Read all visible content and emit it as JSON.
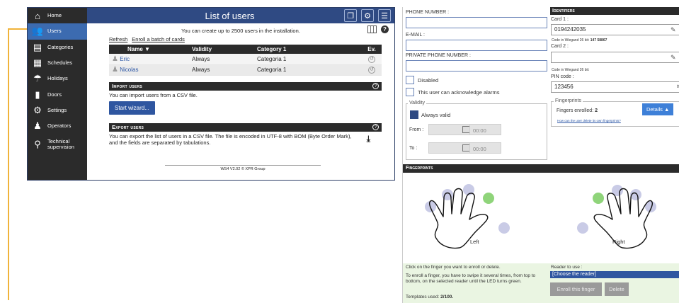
{
  "sidebar": {
    "items": [
      {
        "label": "Home",
        "icon": "home-icon",
        "active": false
      },
      {
        "label": "Users",
        "icon": "users-icon",
        "active": true
      },
      {
        "label": "Categories",
        "icon": "categories-icon",
        "active": false
      },
      {
        "label": "Schedules",
        "icon": "calendar-icon",
        "active": false
      },
      {
        "label": "Holidays",
        "icon": "holidays-icon",
        "active": false
      },
      {
        "label": "Doors",
        "icon": "door-icon",
        "active": false
      },
      {
        "label": "Settings",
        "icon": "gear-icon",
        "active": false
      },
      {
        "label": "Operators",
        "icon": "operators-icon",
        "active": false
      },
      {
        "label": "Technical supervision",
        "icon": "supervision-icon",
        "active": false
      }
    ]
  },
  "users_page": {
    "title": "List of users",
    "capacity_note": "You can create up to 2500 users in the installation.",
    "links": {
      "refresh": "Refresh",
      "enroll_batch": "Enroll a batch of cards"
    },
    "table": {
      "headers": {
        "name": "Name ▼",
        "validity": "Validity",
        "category": "Category 1",
        "ev": "Ev."
      },
      "rows": [
        {
          "name": "Eric",
          "validity": "Always",
          "category": "Categoria 1"
        },
        {
          "name": "Nicolas",
          "validity": "Always",
          "category": "Categoria 1"
        }
      ]
    },
    "import": {
      "title": "Import users",
      "text": "You can import users from a CSV file.",
      "button": "Start wizard..."
    },
    "export": {
      "title": "Export users",
      "text": "You can export the list of users in a CSV file. The file is encoded in UTF-8 with BOM (Byte Order Mark), and the fields are separated by tabulations."
    },
    "footer": "WS4 V2.02 © XPR Group"
  },
  "user_form": {
    "phone_label": "PHONE NUMBER :",
    "email_label": "E-MAIL :",
    "private_phone_label": "PRIVATE PHONE NUMBER :",
    "disabled_label": "Disabled",
    "acknowledge_label": "This user can acknowledge alarms",
    "validity": {
      "legend": "Validity",
      "always_valid_label": "Always valid",
      "always_valid": true,
      "from_label": "From :",
      "to_label": "To :",
      "from_time": "00:00",
      "to_time": "00:00"
    }
  },
  "identifiers": {
    "title": "Identifiers",
    "card1_label": "Card 1 :",
    "card1_value": "0194242035",
    "card1_wiegand_prefix": "Code in Wiegand 26 bit:",
    "card1_wiegand_value": "147 58867",
    "card2_label": "Card 2 :",
    "card2_value": "",
    "card2_wiegand": "Code in Wiegand 26 bit:",
    "pin_label": "PIN code :",
    "pin_value": "123456",
    "fingerprints_legend": "Fingerprints",
    "fingers_enrolled_prefix": "Fingers enrolled:",
    "fingers_enrolled_count": "2",
    "details_button": "Details ▲",
    "delete_link": "How can the user delete its own fingerprints?"
  },
  "fingerprints": {
    "title": "Fingerprints",
    "left_label": "Left",
    "right_label": "Right",
    "enrolled_color": "#8fd47a",
    "available_color": "#c9cbe6",
    "instruction": "Click on the finger you want to enroll or delete.",
    "enroll_help": "To enroll a finger, you have to swipe it several times, from top to bottom, on the selected reader until the LED turns green.",
    "templates_prefix": "Templates used:",
    "templates_value": "2/100.",
    "reader_label": "Reader to use :",
    "reader_value": "[Choose the reader]",
    "enroll_button": "Enroll this finger",
    "delete_button": "Delete"
  },
  "colors": {
    "title_bar": "#2f4a83",
    "sidebar_bg": "#2b2b2b",
    "sidebar_active": "#3c6bb0",
    "accent_guide": "#f0b33a"
  }
}
